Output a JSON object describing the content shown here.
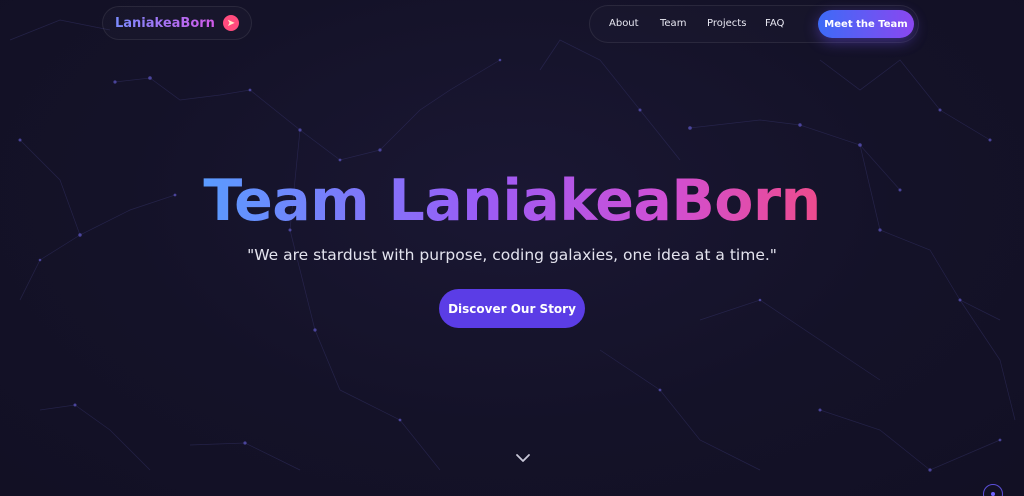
{
  "header": {
    "brand_name": "LaniakeaBorn",
    "brand_icon": "rocket-icon",
    "nav_links": [
      "About",
      "Team",
      "Projects",
      "FAQ"
    ],
    "cta_label": "Meet the Team"
  },
  "hero": {
    "title": "Team LaniakeaBorn",
    "tagline": "\"We are stardust with purpose, coding galaxies, one idea at a time.\"",
    "cta_label": "Discover Our Story"
  },
  "footer": {
    "scroll_icon": "chevron-down-icon",
    "floating_icon": "circle-dot-icon"
  },
  "colors": {
    "background": "#141228",
    "accent": "#5b3de6",
    "gradient_start": "#5a9bff",
    "gradient_end": "#ee4b8c"
  }
}
